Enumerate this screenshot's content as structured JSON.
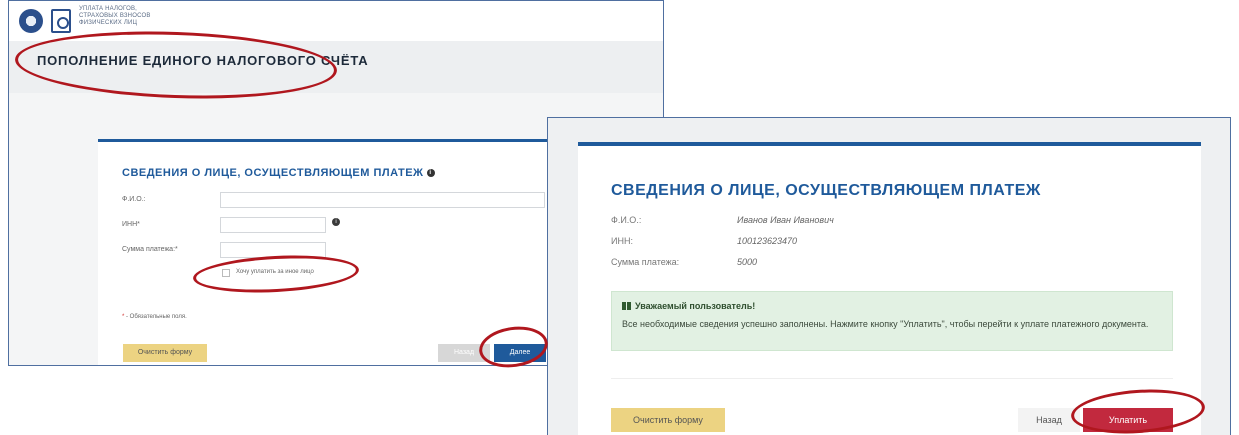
{
  "left": {
    "logo_text": "УПЛАТА НАЛОГОВ, СТРАХОВЫХ ВЗНОСОВ ФИЗИЧЕСКИХ ЛИЦ",
    "page_title": "ПОПОЛНЕНИЕ ЕДИНОГО НАЛОГОВОГО СЧЁТА",
    "form_title": "СВЕДЕНИЯ О ЛИЦЕ, ОСУЩЕСТВЛЯЮЩЕМ ПЛАТЕЖ",
    "label_fio": "Ф.И.О.:",
    "label_inn": "ИНН*",
    "label_sum": "Сумма платежа:*",
    "checkbox_label": "Хочу уплатить за иное лицо",
    "required_note": "- Обязательные поля.",
    "required_mark": "*",
    "btn_clear": "Очистить форму",
    "btn_back": "Назад",
    "btn_next": "Далее"
  },
  "right": {
    "form_title": "СВЕДЕНИЯ О ЛИЦЕ, ОСУЩЕСТВЛЯЮЩЕМ ПЛАТЕЖ",
    "label_fio": "Ф.И.О.:",
    "value_fio": "Иванов Иван Иванович",
    "label_inn": "ИНН:",
    "value_inn": "100123623470",
    "label_sum": "Сумма платежа:",
    "value_sum": "5000",
    "alert_title": "Уважаемый пользователь!",
    "alert_text": "Все необходимые сведения успешно заполнены. Нажмите кнопку \"Уплатить\", чтобы перейти к уплате платежного документа.",
    "btn_clear": "Очистить форму",
    "btn_back": "Назад",
    "btn_pay": "Уплатить"
  },
  "colors": {
    "accent_blue": "#1f5a9b",
    "annotation_red": "#b0171e",
    "pay_button": "#c2293e",
    "clear_button": "#ecd382",
    "alert_bg": "#e2f1e3"
  }
}
